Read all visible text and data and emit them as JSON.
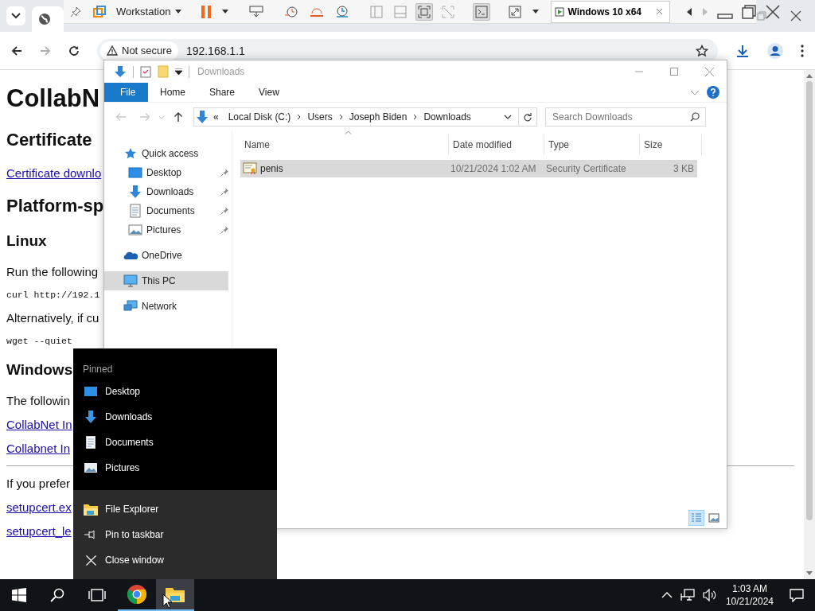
{
  "vm_toolbar": {
    "menu_label": "Workstation",
    "vm_tab": {
      "label": "Windows 10 x64",
      "selected": true
    }
  },
  "browser": {
    "nav_buttons": [
      {
        "kind": "back",
        "disabled": false
      },
      {
        "kind": "forward",
        "disabled": true
      },
      {
        "kind": "reload",
        "disabled": false
      }
    ],
    "address": {
      "security_label": "Not secure",
      "url": "192.168.1.1"
    },
    "page": [
      {
        "kind": "h1",
        "text": "CollabN"
      },
      {
        "kind": "h2",
        "text": "Certificate"
      },
      {
        "kind": "link",
        "text": "Certificate downlo"
      },
      {
        "kind": "h2",
        "text": "Platform-sp"
      },
      {
        "kind": "h3",
        "text": "Linux"
      },
      {
        "kind": "p",
        "text": "Run the following"
      },
      {
        "kind": "code",
        "text": "curl http://192.1"
      },
      {
        "kind": "p",
        "text": "Alternatively, if cu"
      },
      {
        "kind": "code",
        "text": "wget --quiet"
      },
      {
        "kind": "h3",
        "text": "Windows"
      },
      {
        "kind": "p",
        "text": "The followin"
      },
      {
        "kind": "link",
        "text": "CollabNet In"
      },
      {
        "kind": "link",
        "text": "Collabnet In"
      },
      {
        "kind": "rule"
      },
      {
        "kind": "p",
        "text": "If you prefer"
      },
      {
        "kind": "link",
        "text": "setupcert.ex"
      },
      {
        "kind": "link",
        "text": "setupcert_le"
      }
    ]
  },
  "explorer": {
    "title": "Downloads",
    "ribbon_tabs": [
      {
        "kind": "file",
        "label": "File"
      },
      {
        "kind": "tab",
        "label": "Home"
      },
      {
        "kind": "tab",
        "label": "Share"
      },
      {
        "kind": "tab",
        "label": "View"
      }
    ],
    "nav_buttons": [
      {
        "kind": "back",
        "disabled": true
      },
      {
        "kind": "forward",
        "disabled": true
      },
      {
        "kind": "recent",
        "disabled": true
      },
      {
        "kind": "up",
        "disabled": false
      }
    ],
    "overflow_mark": "«",
    "breadcrumbs": [
      "Local Disk (C:)",
      "Users",
      "Joseph Biden",
      "Downloads"
    ],
    "search": {
      "placeholder": "Search Downloads"
    },
    "nav_pane": [
      {
        "kind": "quick-access",
        "label": "Quick access",
        "selected": false,
        "children": [
          {
            "kind": "desktop",
            "label": "Desktop",
            "selected": false,
            "pinned": true
          },
          {
            "kind": "downloads",
            "label": "Downloads",
            "selected": false,
            "pinned": true
          },
          {
            "kind": "documents",
            "label": "Documents",
            "selected": false,
            "pinned": true
          },
          {
            "kind": "pictures",
            "label": "Pictures",
            "selected": false,
            "pinned": true
          }
        ]
      },
      {
        "kind": "onedrive",
        "label": "OneDrive",
        "selected": false
      },
      {
        "kind": "this-pc",
        "label": "This PC",
        "selected": true
      },
      {
        "kind": "network",
        "label": "Network",
        "selected": false
      }
    ],
    "columns": [
      {
        "label": "Name",
        "sorted": true
      },
      {
        "label": "Date modified",
        "sorted": false
      },
      {
        "label": "Type",
        "sorted": false
      },
      {
        "label": "Size",
        "sorted": false
      }
    ],
    "files": [
      {
        "name": "penis",
        "date_modified": "10/21/2024 1:02 AM",
        "type": "Security Certificate",
        "size": "3 KB",
        "selected": true
      }
    ],
    "view_buttons": [
      {
        "kind": "details",
        "selected": true
      },
      {
        "kind": "large-icons",
        "selected": false
      }
    ]
  },
  "jump_list": {
    "section": "Pinned",
    "pinned": [
      {
        "kind": "desktop",
        "label": "Desktop"
      },
      {
        "kind": "downloads",
        "label": "Downloads"
      },
      {
        "kind": "documents",
        "label": "Documents"
      },
      {
        "kind": "pictures",
        "label": "Pictures"
      }
    ],
    "tasks": [
      {
        "kind": "explorer",
        "label": "File Explorer"
      },
      {
        "kind": "pin",
        "label": "Pin to taskbar"
      },
      {
        "kind": "close",
        "label": "Close window"
      }
    ]
  },
  "taskbar": {
    "apps": [
      {
        "kind": "chrome",
        "running": true,
        "active": false
      },
      {
        "kind": "explorer",
        "running": true,
        "active": true
      }
    ],
    "clock": {
      "time": "1:03 AM",
      "date": "10/21/2024"
    }
  }
}
